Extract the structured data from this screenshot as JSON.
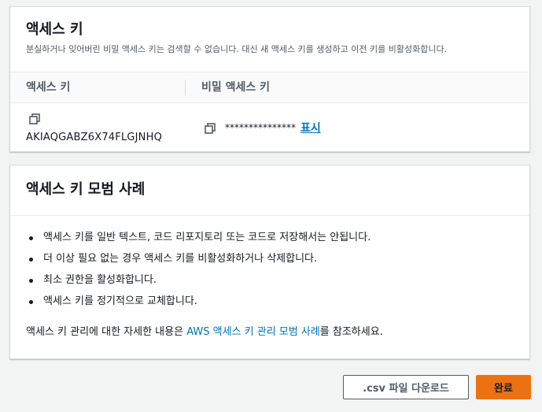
{
  "access_keys": {
    "title": "액세스 키",
    "description": "분실하거나 잊어버린 비밀 액세스 키는 검색할 수 없습니다. 대신 새 액세스 키를 생성하고 이전 키를 비활성화합니다.",
    "columns": {
      "access_key": "액세스 키",
      "secret_key": "비밀 액세스 키"
    },
    "row": {
      "access_key_id": "AKIAQGABZ6X74FLGJNHQ",
      "secret_masked": "***************",
      "show_label": "표시"
    }
  },
  "best_practices": {
    "title": "액세스 키 모범 사례",
    "items": [
      "액세스 키를 일반 텍스트, 코드 리포지토리 또는 코드로 저장해서는 안됩니다.",
      "더 이상 필요 없는 경우 액세스 키를 비활성화하거나 삭제합니다.",
      "최소 권한을 활성화합니다.",
      "액세스 키를 정기적으로 교체합니다."
    ],
    "footnote_before": "액세스 키 관리에 대한 자세한 내용은 ",
    "footnote_link": "AWS 액세스 키 관리 모범 사례",
    "footnote_after": "를 참조하세요."
  },
  "actions": {
    "download_csv": ".csv 파일 다운로드",
    "done": "완료"
  },
  "colors": {
    "link": "#0073bb",
    "primary_button": "#ec7211",
    "background": "#f2f3f3"
  },
  "icons": {
    "copy": "copy-icon"
  }
}
